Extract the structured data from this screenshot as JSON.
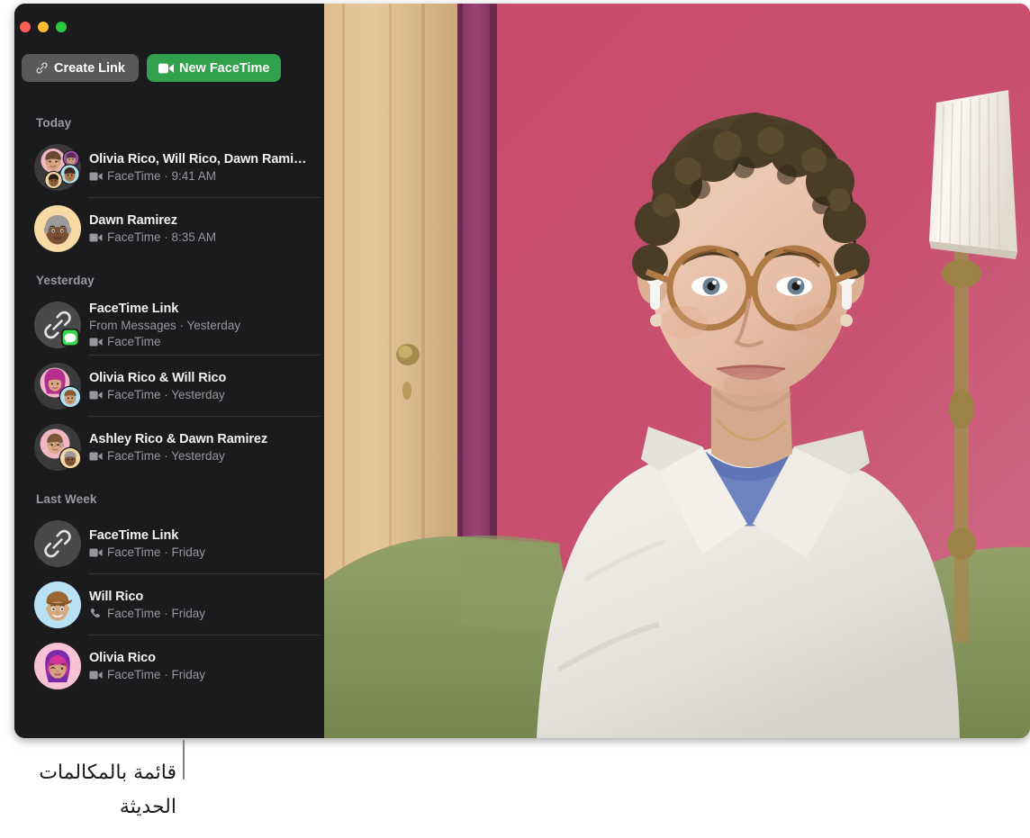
{
  "window": {
    "traffic_lights": [
      {
        "name": "close",
        "color": "#ff5f57"
      },
      {
        "name": "minimize",
        "color": "#febc2e"
      },
      {
        "name": "maximize",
        "color": "#28c840"
      }
    ],
    "sidebar_bg": "#1b1b1d"
  },
  "toolbar": {
    "create_link_label": "Create Link",
    "new_facetime_label": "New FaceTime",
    "create_link_icon": "link-icon",
    "new_facetime_icon": "video-camera-icon",
    "new_facetime_color": "#31a14b",
    "create_link_color": "#59595c"
  },
  "sections": [
    {
      "header": "Today",
      "rows": [
        {
          "title": "Olivia Rico, Will Rico, Dawn Rami…",
          "subtitle": "FaceTime · 9:41 AM",
          "icon": "video-camera-icon",
          "avatar": "group-four",
          "separator": true
        },
        {
          "title": "Dawn Ramirez",
          "subtitle": "FaceTime · 8:35 AM",
          "icon": "video-camera-icon",
          "avatar": "memoji-dawn",
          "separator": false
        }
      ]
    },
    {
      "header": "Yesterday",
      "rows": [
        {
          "title": "FaceTime Link",
          "subtitle_extra": "From Messages · Yesterday",
          "subtitle": "FaceTime",
          "icon": "video-camera-icon",
          "avatar": "link-badge-messages",
          "separator": true
        },
        {
          "title": "Olivia Rico & Will Rico",
          "subtitle": "FaceTime · Yesterday",
          "icon": "video-camera-icon",
          "avatar": "pair-olivia-will",
          "separator": true
        },
        {
          "title": "Ashley Rico & Dawn Ramirez",
          "subtitle": "FaceTime · Yesterday",
          "icon": "video-camera-icon",
          "avatar": "pair-ashley-dawn",
          "separator": false
        }
      ]
    },
    {
      "header": "Last Week",
      "rows": [
        {
          "title": "FaceTime Link",
          "subtitle": "FaceTime · Friday",
          "icon": "video-camera-icon",
          "avatar": "link-plain",
          "separator": true
        },
        {
          "title": "Will Rico",
          "subtitle": "FaceTime · Friday",
          "icon": "phone-icon",
          "avatar": "memoji-will",
          "separator": true
        },
        {
          "title": "Olivia Rico",
          "subtitle": "FaceTime · Friday",
          "icon": "video-camera-icon",
          "avatar": "memoji-olivia",
          "separator": false
        }
      ]
    }
  ],
  "video": {
    "description": "facetime-video-self-view",
    "wall_color": "#c0506e",
    "door_color": "#d9b183",
    "trim_color": "#8e3a63",
    "couch_color": "#8b9a62",
    "shirt_color": "#eceae2",
    "tee_color": "#6f82c0"
  },
  "callout": {
    "text_line1": "قائمة بالمكالمات",
    "text_line2": "الحديثة"
  }
}
